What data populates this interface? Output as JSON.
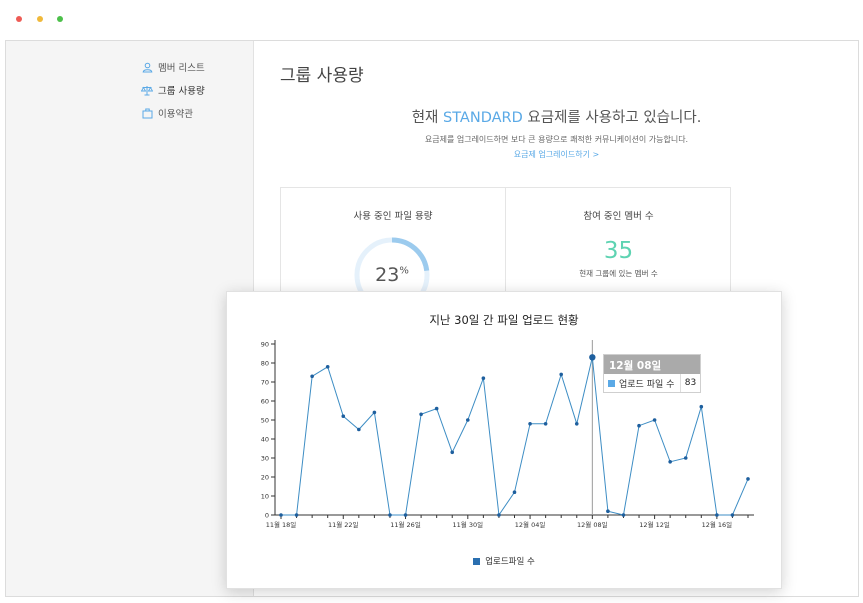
{
  "sidebar": {
    "items": [
      {
        "label": "멤버 리스트",
        "icon": "user-icon"
      },
      {
        "label": "그룹 사용량",
        "icon": "scale-icon"
      },
      {
        "label": "이용약관",
        "icon": "briefcase-icon"
      }
    ]
  },
  "main": {
    "title": "그룹 사용량",
    "headline_prefix": "현재",
    "plan_name": "STANDARD",
    "headline_suffix": "요금제를 사용하고 있습니다.",
    "subtext": "요금제를 업그레이드하면 보다 큰 용량으로 쾌적한 커뮤니케이션이 가능합니다.",
    "upgrade_link": "요금제 업그레이드하기 >"
  },
  "storage_card": {
    "title": "사용 중인 파일 용량",
    "percent_value": "23",
    "percent_sign": "%",
    "fraction": 0.23
  },
  "member_card": {
    "title": "참여 중인 멤버 수",
    "count": "35",
    "subtitle": "현재 그룹에 있는 멤버 수"
  },
  "colors": {
    "accent": "#5aa9e6",
    "member_count": "#5ed3b2",
    "line": "#3d8dc4",
    "point": "#1e5f9e"
  },
  "chart_data": {
    "type": "line",
    "title": "지난 30일 간 파일 업로드 현황",
    "ylim": [
      0,
      90
    ],
    "yticks": [
      0,
      10,
      20,
      30,
      40,
      50,
      60,
      70,
      80,
      90
    ],
    "xtick_labels": [
      {
        "index": 0,
        "label": "11월 18일"
      },
      {
        "index": 4,
        "label": "11월 22일"
      },
      {
        "index": 8,
        "label": "11월 26일"
      },
      {
        "index": 12,
        "label": "11월 30일"
      },
      {
        "index": 16,
        "label": "12월 04일"
      },
      {
        "index": 20,
        "label": "12월 08일"
      },
      {
        "index": 24,
        "label": "12월 12일"
      },
      {
        "index": 28,
        "label": "12월 16일"
      }
    ],
    "series": [
      {
        "name": "업로드파일 수",
        "values": [
          0,
          0,
          73,
          78,
          52,
          45,
          54,
          0,
          0,
          53,
          56,
          33,
          50,
          72,
          0,
          12,
          48,
          48,
          74,
          48,
          83,
          2,
          0,
          47,
          50,
          28,
          30,
          57,
          0,
          0,
          19
        ]
      }
    ],
    "highlight_index": 20,
    "tooltip": {
      "date": "12월 08일",
      "label": "업로드 파일 수",
      "value": "83"
    }
  }
}
